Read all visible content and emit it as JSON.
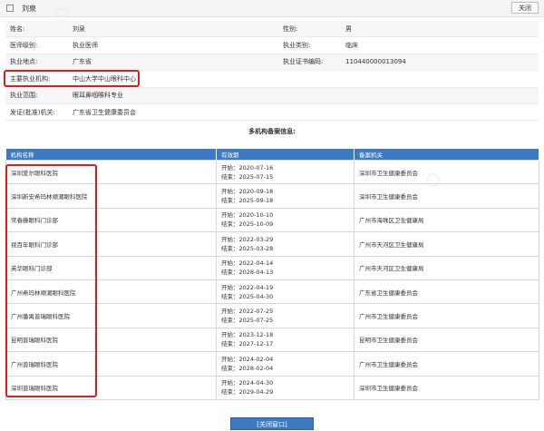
{
  "window": {
    "title": "刘泉",
    "close_label": "关闭"
  },
  "info": {
    "rows": [
      {
        "k1": "姓名:",
        "v1": "刘泉",
        "k2": "性别:",
        "v2": "男"
      },
      {
        "k1": "医师级别:",
        "v1": "执业医师",
        "k2": "执业类别:",
        "v2": "临床"
      },
      {
        "k1": "执业地点:",
        "v1": "广东省",
        "k2": "执业证书编码:",
        "v2": "110440000013094"
      },
      {
        "k1": "主要执业机构:",
        "v1": "中山大学中山眼科中心",
        "k2": "",
        "v2": ""
      },
      {
        "k1": "执业范围:",
        "v1": "眼耳鼻咽喉科专业",
        "k2": "",
        "v2": ""
      },
      {
        "k1": "发证(批准)机关:",
        "v1": "广东省卫生健康委员会",
        "k2": "",
        "v2": ""
      }
    ]
  },
  "multi_title": "多机构备案信息:",
  "table": {
    "headers": [
      "机构名称",
      "有效期",
      "备案机关"
    ],
    "rows": [
      {
        "org": "深圳爱尔眼科医院",
        "start": "开始：2020-07-16",
        "end": "结束：2025-07-15",
        "auth": "深圳市卫生健康委员会"
      },
      {
        "org": "深圳新安希玛林顺潮眼科医院",
        "start": "开始：2020-09-18",
        "end": "结束：2025-09-18",
        "auth": "深圳市卫生健康委员会"
      },
      {
        "org": "常春藤眼科门诊部",
        "start": "开始：2020-10-10",
        "end": "结束：2025-10-09",
        "auth": "广州市海珠区卫生健康局"
      },
      {
        "org": "视百年眼科门诊部",
        "start": "开始：2022-03-29",
        "end": "结束：2025-03-28",
        "auth": "广州市天河区卫生健康局"
      },
      {
        "org": "英华眼科门诊部",
        "start": "开始：2022-04-14",
        "end": "结束：2028-04-13",
        "auth": "广州市天河区卫生健康局"
      },
      {
        "org": "广州希玛林顺潮眼科医院",
        "start": "开始：2022-04-19",
        "end": "结束：2025-04-30",
        "auth": "广东省卫生健康委员会"
      },
      {
        "org": "广州番禺普瑞眼科医院",
        "start": "开始：2022-07-25",
        "end": "结束：2025-07-25",
        "auth": "广州市卫生健康委员会"
      },
      {
        "org": "昆明普瑞眼科医院",
        "start": "开始：2023-12-18",
        "end": "结束：2027-12-17",
        "auth": "昆明市卫生健康委员会"
      },
      {
        "org": "广州普瑞眼科医院",
        "start": "开始：2024-02-04",
        "end": "结束：2028-02-04",
        "auth": "广州市卫生健康委员会"
      },
      {
        "org": "深圳普瑞眼科医院",
        "start": "开始：2024-04-30",
        "end": "结束：2029-04-29",
        "auth": "深圳市卫生健康委员会"
      }
    ]
  },
  "close_button": "[关闭窗口]",
  "colors": {
    "header_blue": "#3d7ac2",
    "highlight_red": "#d81e1e"
  }
}
